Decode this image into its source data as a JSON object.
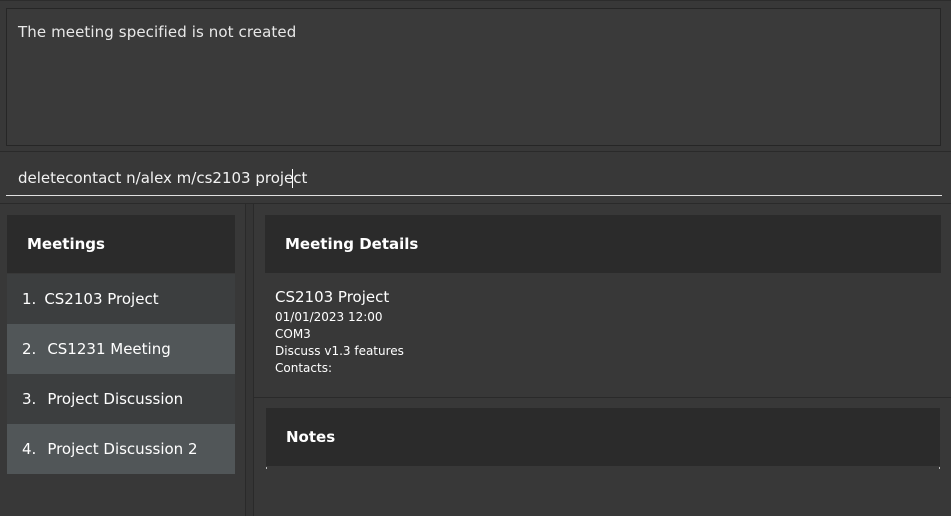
{
  "result": {
    "text": "The meeting specified is not created"
  },
  "command": {
    "value": "deletecontact n/alex m/cs2103 project"
  },
  "meetings": {
    "header": "Meetings",
    "items": [
      {
        "index": "1.",
        "name": "CS2103 Project"
      },
      {
        "index": "2.",
        "name": "CS1231 Meeting"
      },
      {
        "index": "3.",
        "name": "Project Discussion"
      },
      {
        "index": "4.",
        "name": "Project Discussion 2"
      }
    ]
  },
  "details": {
    "header": "Meeting Details",
    "title": "CS2103 Project",
    "datetime": "01/01/2023 12:00",
    "location": "COM3",
    "description": "Discuss v1.3 features",
    "contacts": "Contacts:"
  },
  "notes": {
    "header": "Notes"
  }
}
